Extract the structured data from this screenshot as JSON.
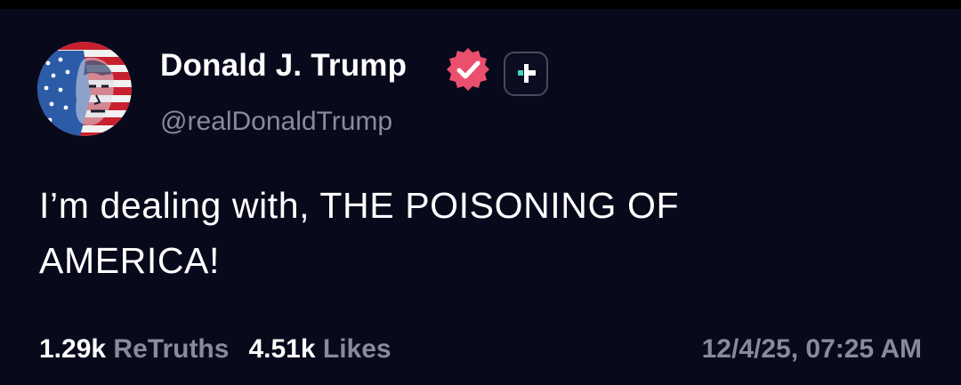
{
  "post": {
    "author": {
      "display_name": "Donald J. Trump",
      "handle": "@realDonaldTrump",
      "verified": true,
      "avatar_icon": "american-flag-portrait-avatar",
      "badge_icon": "plus-badge-icon"
    },
    "text_line_1": "I’m dealing with, THE POISONING OF",
    "text_line_2": "AMERICA!",
    "stats": {
      "retruths_count": "1.29k",
      "retruths_label": "ReTruths",
      "likes_count": "4.51k",
      "likes_label": "Likes"
    },
    "timestamp": "12/4/25, 07:25 AM"
  },
  "colors": {
    "background": "#09091c",
    "text_primary": "#ffffff",
    "text_secondary": "#8a8a98",
    "verified_badge": "#ea4f6e",
    "plus_accent": "#3fd3c0"
  }
}
